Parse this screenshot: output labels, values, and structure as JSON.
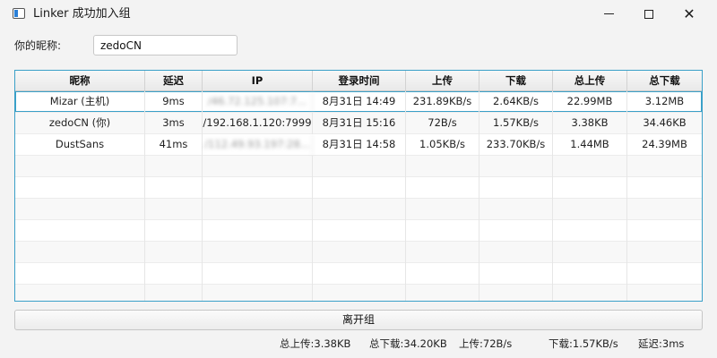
{
  "window": {
    "title": "Linker 成功加入组",
    "icon": "app-window-icon",
    "controls": [
      "minimize",
      "maximize",
      "close"
    ],
    "accent_color": "#3aa0c8"
  },
  "nickname": {
    "label": "你的昵称:",
    "value": "zedoCN"
  },
  "table": {
    "columns": [
      "昵称",
      "延迟",
      "IP",
      "登录时间",
      "上传",
      "下载",
      "总上传",
      "总下载"
    ],
    "rows": [
      [
        "Mizar (主机)",
        "9ms",
        "/46.72.125.107:7...",
        "8月31日 14:49",
        "231.89KB/s",
        "2.64KB/s",
        "22.99MB",
        "3.12MB"
      ],
      [
        "zedoCN (你)",
        "3ms",
        "/192.168.1.120:7999",
        "8月31日 15:16",
        "72B/s",
        "1.57KB/s",
        "3.38KB",
        "34.46KB"
      ],
      [
        "DustSans",
        "41ms",
        "/112.49.93.197:28...",
        "8月31日 14:58",
        "1.05KB/s",
        "233.70KB/s",
        "1.44MB",
        "24.39MB"
      ]
    ],
    "selected_row": 0,
    "blurred_column": 2,
    "empty_rows": 7
  },
  "actions": {
    "leave_label": "离开组"
  },
  "status_bar": {
    "total_upload": "总上传:3.38KB",
    "total_download": "总下载:34.20KB",
    "upload": "上传:72B/s",
    "download": "下载:1.57KB/s",
    "latency": "延迟:3ms"
  }
}
